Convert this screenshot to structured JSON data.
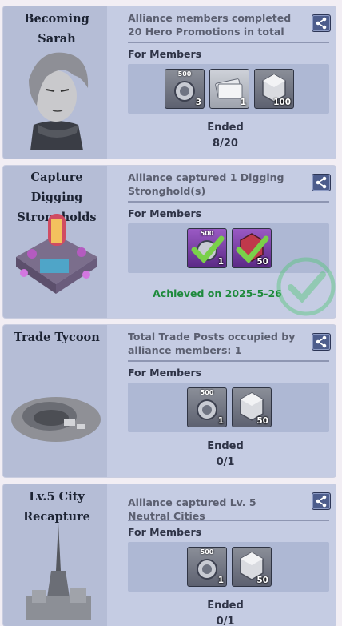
{
  "cards": [
    {
      "title_line1": "Becoming",
      "title_line2": "Sarah",
      "description": "Alliance members completed 20 Hero Promotions in total",
      "for_members": "For Members",
      "rewards": [
        {
          "icon": "medal-badge-icon",
          "top": "500",
          "qty": "3"
        },
        {
          "icon": "tickets-icon",
          "qty": "1"
        },
        {
          "icon": "crystal-icon",
          "qty": "100"
        }
      ],
      "status_label": "Ended",
      "progress": "8/20"
    },
    {
      "title_line1": "Capture Digging",
      "title_line2": "Strongholds",
      "description": "Alliance captured 1 Digging Stronghold(s)",
      "for_members": "For Members",
      "rewards": [
        {
          "icon": "medal-badge-icon",
          "top": "500",
          "qty": "1",
          "claimed": true
        },
        {
          "icon": "crystal-icon",
          "qty": "50",
          "claimed": true
        }
      ],
      "achieved_text": "Achieved on 2025-5-26"
    },
    {
      "title_line1": "Trade Tycoon",
      "description": "Total Trade Posts occupied by alliance members: 1",
      "for_members": "For Members",
      "rewards": [
        {
          "icon": "medal-badge-icon",
          "top": "500",
          "qty": "1"
        },
        {
          "icon": "crystal-icon",
          "qty": "50"
        }
      ],
      "status_label": "Ended",
      "progress": "0/1"
    },
    {
      "title_line1": "Lv.5 City",
      "title_line2": "Recapture",
      "description": "Alliance captured Lv. 5 Neutral Cities",
      "for_members": "For Members",
      "rewards": [
        {
          "icon": "medal-badge-icon",
          "top": "500",
          "qty": "1"
        },
        {
          "icon": "crystal-icon",
          "qty": "50"
        }
      ],
      "status_label": "Ended",
      "progress": "0/1"
    }
  ],
  "colors": {
    "achieved": "#1e8a3c",
    "share_button": "#4d5d8c"
  }
}
